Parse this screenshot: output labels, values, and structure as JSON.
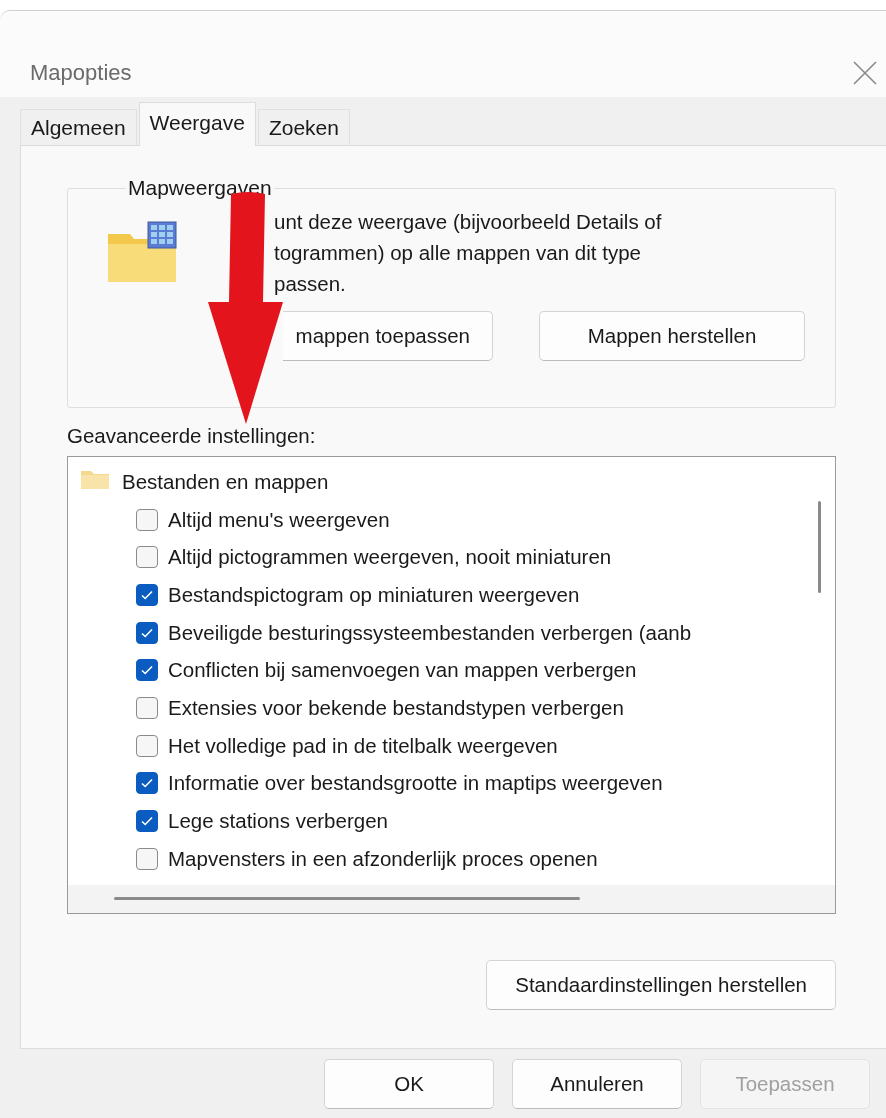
{
  "window": {
    "title": "Mapopties"
  },
  "tabs": [
    {
      "label": "Algemeen",
      "selected": false
    },
    {
      "label": "Weergave",
      "selected": true
    },
    {
      "label": "Zoeken",
      "selected": false
    }
  ],
  "folder_views": {
    "legend": "Mapweergaven",
    "description": "unt deze weergave (bijvoorbeeld Details of\ntogrammen) op alle mappen van dit type\npassen.",
    "buttons": [
      {
        "label": "mappen toepassen"
      },
      {
        "label": "Mappen herstellen"
      }
    ]
  },
  "advanced": {
    "label": "Geavanceerde instellingen:",
    "tree": [
      {
        "label": "Bestanden en mappen",
        "children": [
          {
            "label": "Altijd menu's weergeven",
            "checked": false
          },
          {
            "label": "Altijd pictogrammen weergeven, nooit miniaturen",
            "checked": false
          },
          {
            "label": "Bestandspictogram op miniaturen weergeven",
            "checked": true
          },
          {
            "label": "Beveiligde besturingssysteembestanden verbergen (aanb",
            "checked": true
          },
          {
            "label": "Conflicten bij samenvoegen van mappen verbergen",
            "checked": true
          },
          {
            "label": "Extensies voor bekende bestandstypen verbergen",
            "checked": false
          },
          {
            "label": "Het volledige pad in de titelbalk weergeven",
            "checked": false
          },
          {
            "label": "Informatie over bestandsgrootte in maptips weergeven",
            "checked": true
          },
          {
            "label": "Lege stations verbergen",
            "checked": true
          },
          {
            "label": "Mapvensters in een afzonderlijk proces openen",
            "checked": false
          }
        ]
      }
    ]
  },
  "restore_defaults_button": "Standaardinstellingen herstellen",
  "buttons": [
    {
      "label": "OK",
      "disabled": false
    },
    {
      "label": "Annuleren",
      "disabled": false
    },
    {
      "label": "Toepassen",
      "disabled": true
    }
  ]
}
